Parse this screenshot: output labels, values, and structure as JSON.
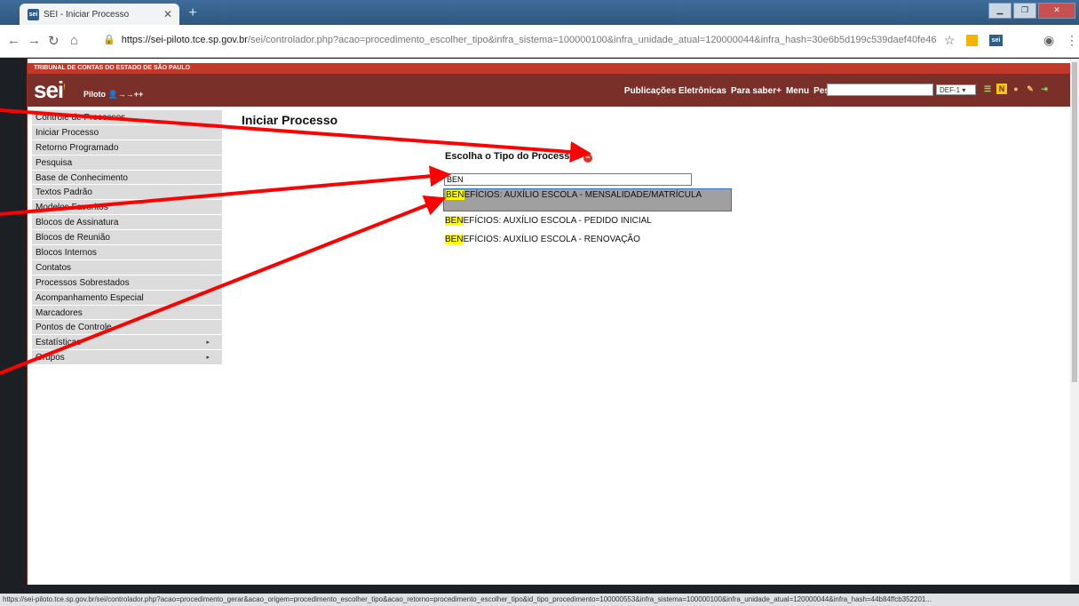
{
  "browser": {
    "tab_title": "SEI - Iniciar Processo",
    "tab_favicon": "sei",
    "new_tab": "+",
    "url_host": "https://sei-piloto.tce.sp.gov.br",
    "url_rest": "/sei/controlador.php?acao=procedimento_escolher_tipo&infra_sistema=100000100&infra_unidade_atual=120000044&infra_hash=30e6b5d199c539daef40fe46b3e840...",
    "status_url": "https://sei-piloto.tce.sp.gov.br/sei/controlador.php?acao=procedimento_gerar&acao_origem=procedimento_escolher_tipo&acao_retorno=procedimento_escolher_tipo&id_tipo_procedimento=100000553&infra_sistema=100000100&infra_unidade_atual=120000044&infra_hash=44b84ffcb352201...",
    "icons": [
      "back-icon",
      "forward-icon",
      "reload-icon",
      "home-icon",
      "lock-icon",
      "star-icon",
      "profile-icon",
      "menu-icon"
    ]
  },
  "header": {
    "org_name": "TRIBUNAL DE CONTAS DO ESTADO DE SÃO PAULO",
    "logo": "sei",
    "env_label": "Piloto",
    "nav_links": [
      "Publicações Eletrônicas",
      "Para saber+",
      "Menu",
      "Pesquisa"
    ],
    "unit_selected": "DEF-1",
    "colors": {
      "org_bar": "#c0392b",
      "main_bar": "#7a3028"
    }
  },
  "sidebar": {
    "items": [
      {
        "label": "Controle de Processos"
      },
      {
        "label": "Iniciar Processo"
      },
      {
        "label": "Retorno Programado"
      },
      {
        "label": "Pesquisa"
      },
      {
        "label": "Base de Conhecimento"
      },
      {
        "label": "Textos Padrão"
      },
      {
        "label": "Modelos Favoritos"
      },
      {
        "label": "Blocos de Assinatura"
      },
      {
        "label": "Blocos de Reunião"
      },
      {
        "label": "Blocos Internos"
      },
      {
        "label": "Contatos"
      },
      {
        "label": "Processos Sobrestados"
      },
      {
        "label": "Acompanhamento Especial"
      },
      {
        "label": "Marcadores"
      },
      {
        "label": "Pontos de Controle"
      },
      {
        "label": "Estatísticas",
        "submenu": "▸"
      },
      {
        "label": "Grupos",
        "submenu": "▸"
      }
    ]
  },
  "main": {
    "title": "Iniciar Processo",
    "choose_label": "Escolha o Tipo do Processo:",
    "filter_value": "BEN",
    "options": [
      {
        "match": "BEN",
        "rest": "EFÍCIOS: AUXÍLIO ESCOLA - MENSALIDADE/MATRÍCULA",
        "selected": true
      },
      {
        "match": "BEN",
        "rest": "EFÍCIOS: AUXÍLIO ESCOLA - PEDIDO INICIAL",
        "selected": false
      },
      {
        "match": "BEN",
        "rest": "EFÍCIOS: AUXÍLIO ESCOLA - RENOVAÇÃO",
        "selected": false
      }
    ],
    "highlight_color": "#ffff00"
  }
}
